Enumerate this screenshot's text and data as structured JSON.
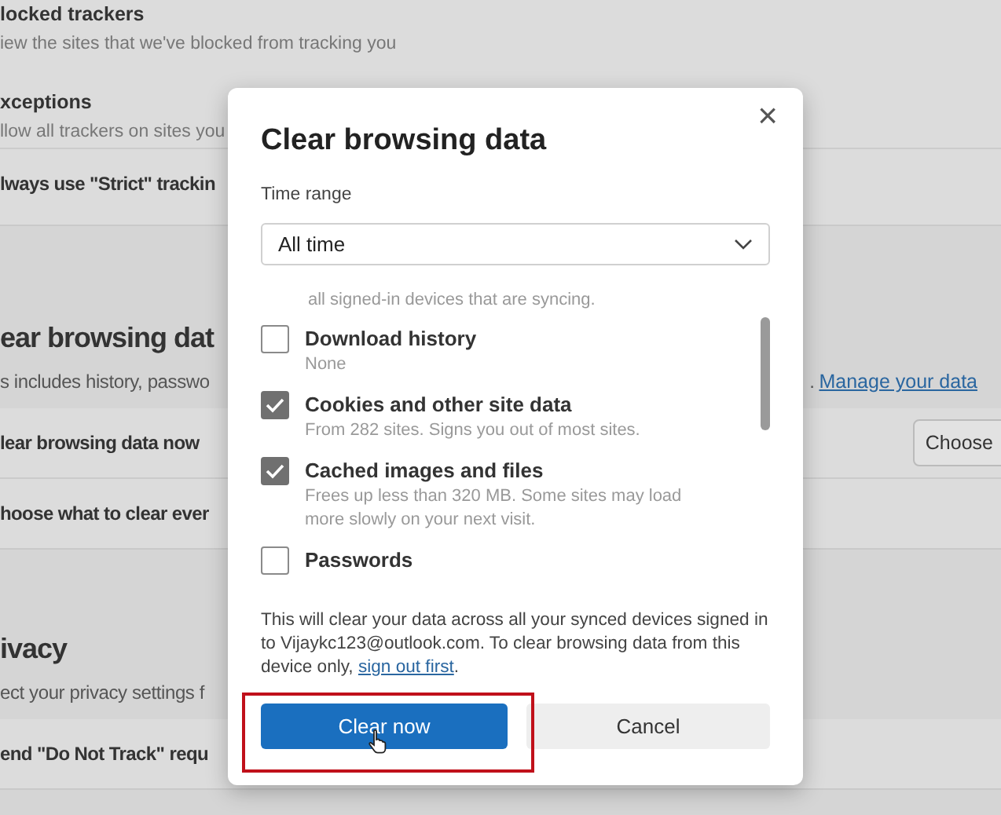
{
  "settings_page": {
    "items": [
      {
        "kind": "title",
        "text": "locked trackers"
      },
      {
        "kind": "desc",
        "text": "iew the sites that we've blocked from tracking you"
      },
      {
        "kind": "title",
        "text": "xceptions"
      },
      {
        "kind": "desc",
        "text": "llow all trackers on sites you"
      },
      {
        "kind": "setting",
        "text": "lways use \"Strict\" trackin"
      },
      {
        "kind": "heading",
        "text": "ear browsing dat"
      },
      {
        "kind": "desc",
        "text": "s includes history, passwo",
        "trailing_text": ".",
        "link": "Manage your data"
      },
      {
        "kind": "setting",
        "text": "lear browsing data now",
        "button": "Choose"
      },
      {
        "kind": "setting",
        "text": "hoose what to clear ever"
      },
      {
        "kind": "heading",
        "text": "ivacy"
      },
      {
        "kind": "desc",
        "text": "ect your privacy settings f"
      },
      {
        "kind": "setting",
        "text": "end \"Do Not Track\" requ"
      }
    ]
  },
  "dialog": {
    "title": "Clear browsing data",
    "close": "×",
    "time_range_label": "Time range",
    "time_range_value": "All time",
    "scrolled_text": "all signed-in devices that are syncing.",
    "options": [
      {
        "label": "Download history",
        "description": "None",
        "checked": false
      },
      {
        "label": "Cookies and other site data",
        "description": "From 282 sites. Signs you out of most sites.",
        "checked": true
      },
      {
        "label": "Cached images and files",
        "description": "Frees up less than 320 MB. Some sites may load more slowly on your next visit.",
        "checked": true
      },
      {
        "label": "Passwords",
        "checked": false
      }
    ],
    "note": "This will clear your data across all your synced devices signed in to Vijaykc123@outlook.com. To clear browsing data from this device only, ",
    "note_link": "sign out first",
    "note_end": ".",
    "buttons": [
      {
        "label": "Clear now",
        "kind": "primary",
        "highlighted": true
      },
      {
        "label": "Cancel",
        "kind": "secondary",
        "highlighted": false
      }
    ]
  }
}
